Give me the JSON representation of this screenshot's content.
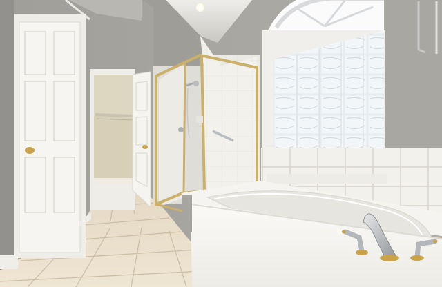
{
  "scene": {
    "subject": "bathroom",
    "palette": {
      "wall": "#a5a39e",
      "wall_shadow": "#8f8d89",
      "ceiling": "#d9d8d4",
      "trim": "#f4f3ef",
      "door": "#f5f4f0",
      "floor_tile": "#e8dcc8",
      "grout": "#cfc2aa",
      "glass_block": "#e9eef2",
      "frame_brass": "#cbb06a",
      "tub": "#f7f6f2",
      "fixture": "#b9bcbf",
      "brass_accent": "#c9a24a",
      "closet": "#d8d0b8"
    }
  }
}
